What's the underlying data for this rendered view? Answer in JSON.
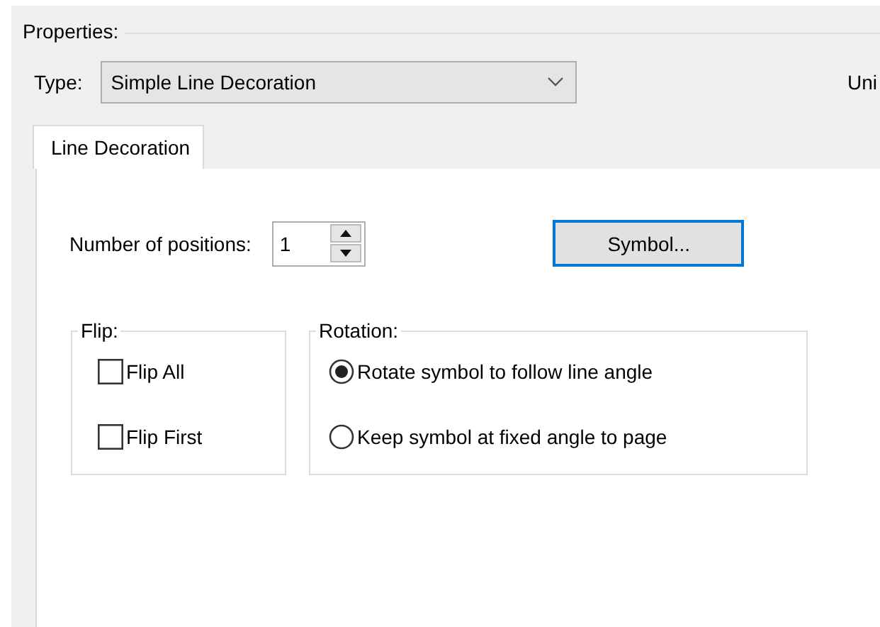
{
  "properties": {
    "label": "Properties:"
  },
  "type_field": {
    "label": "Type:",
    "value": "Simple Line Decoration"
  },
  "cut_label": "Uni",
  "tabs": [
    {
      "label": "Line Decoration",
      "selected": true
    }
  ],
  "positions": {
    "label": "Number of positions:",
    "value": "1"
  },
  "symbol_button": "Symbol...",
  "flip": {
    "title": "Flip:",
    "options": [
      {
        "label": "Flip All",
        "checked": false
      },
      {
        "label": "Flip First",
        "checked": false
      }
    ]
  },
  "rotation": {
    "title": "Rotation:",
    "options": [
      {
        "label": "Rotate symbol to follow line angle",
        "selected": true
      },
      {
        "label": "Keep symbol at fixed angle to page",
        "selected": false
      }
    ]
  }
}
